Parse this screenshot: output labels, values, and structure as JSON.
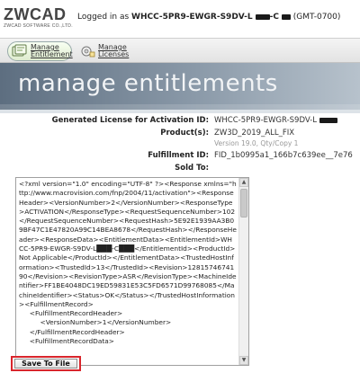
{
  "header": {
    "logo_main": "ZWCAD",
    "logo_sub": "ZWCAD SOFTWARE CO.,LTD.",
    "login_prefix": "Logged in as",
    "login_user": "WHCC-5PR9-EWGR-S9DV-L",
    "login_user_tail": "-C",
    "timezone": "(GMT-0700)"
  },
  "nav": {
    "items": [
      {
        "label": "Manage Entitlement",
        "active": true,
        "icon": "entitlement-icon"
      },
      {
        "label": "Manage Licenses",
        "active": false,
        "icon": "licenses-icon"
      }
    ]
  },
  "banner": {
    "title": "manage entitlements"
  },
  "details": {
    "activation_label": "Generated License for Activation ID:",
    "activation_value": "WHCC-5PR9-EWGR-S9DV-L",
    "product_label": "Product(s):",
    "product_value": "ZW3D_2019_ALL_FIX",
    "product_version": "Version 19.0, Qty/Copy 1",
    "fulfillment_label": "Fulfillment ID:",
    "fulfillment_value": "FID_1b0995a1_166b7c639ee__7e76",
    "soldto_label": "Sold To:",
    "soldto_value": ""
  },
  "xml": {
    "content": "<?xml version=\"1.0\" encoding=\"UTF-8\" ?><Response xmlns=\"http://www.macrovision.com/fnp/2004/11/activation\"><ResponseHeader><VersionNumber>2</VersionNumber><ResponseType>ACTIVATION</ResponseType><RequestSequenceNumber>102</RequestSequenceNumber><RequestHash>5E92E1939AA3B09BF47C1E47820A99C14BEA8678</RequestHash></ResponseHeader><ResponseData><EntitlementData><EntitlementId>WHCC-5PR9-EWGR-S9DV-L███-C███</EntitlementId><ProductId>Not Applicable</ProductId></EntitlementData><TrustedHostInformation><TrustedId>13</TrustedId><Revision>1281574674190</Revision><RevisionType>ASR</RevisionType><MachineIdentifier>FF1BE4048DC19ED59831E53C5FD6571D99768085</MachineIdentifier><Status>OK</Status></TrustedHostInformation><FulfillmentRecord>\n     <FulfillmentRecordHeader>\n          <VersionNumber>1</VersionNumber>\n     </FulfillmentRecordHeader>\n     <FulfillmentRecordData>"
  },
  "actions": {
    "save_label": "Save To File"
  },
  "colors": {
    "highlight": "#d9252c",
    "banner": "#6f7f8f"
  }
}
